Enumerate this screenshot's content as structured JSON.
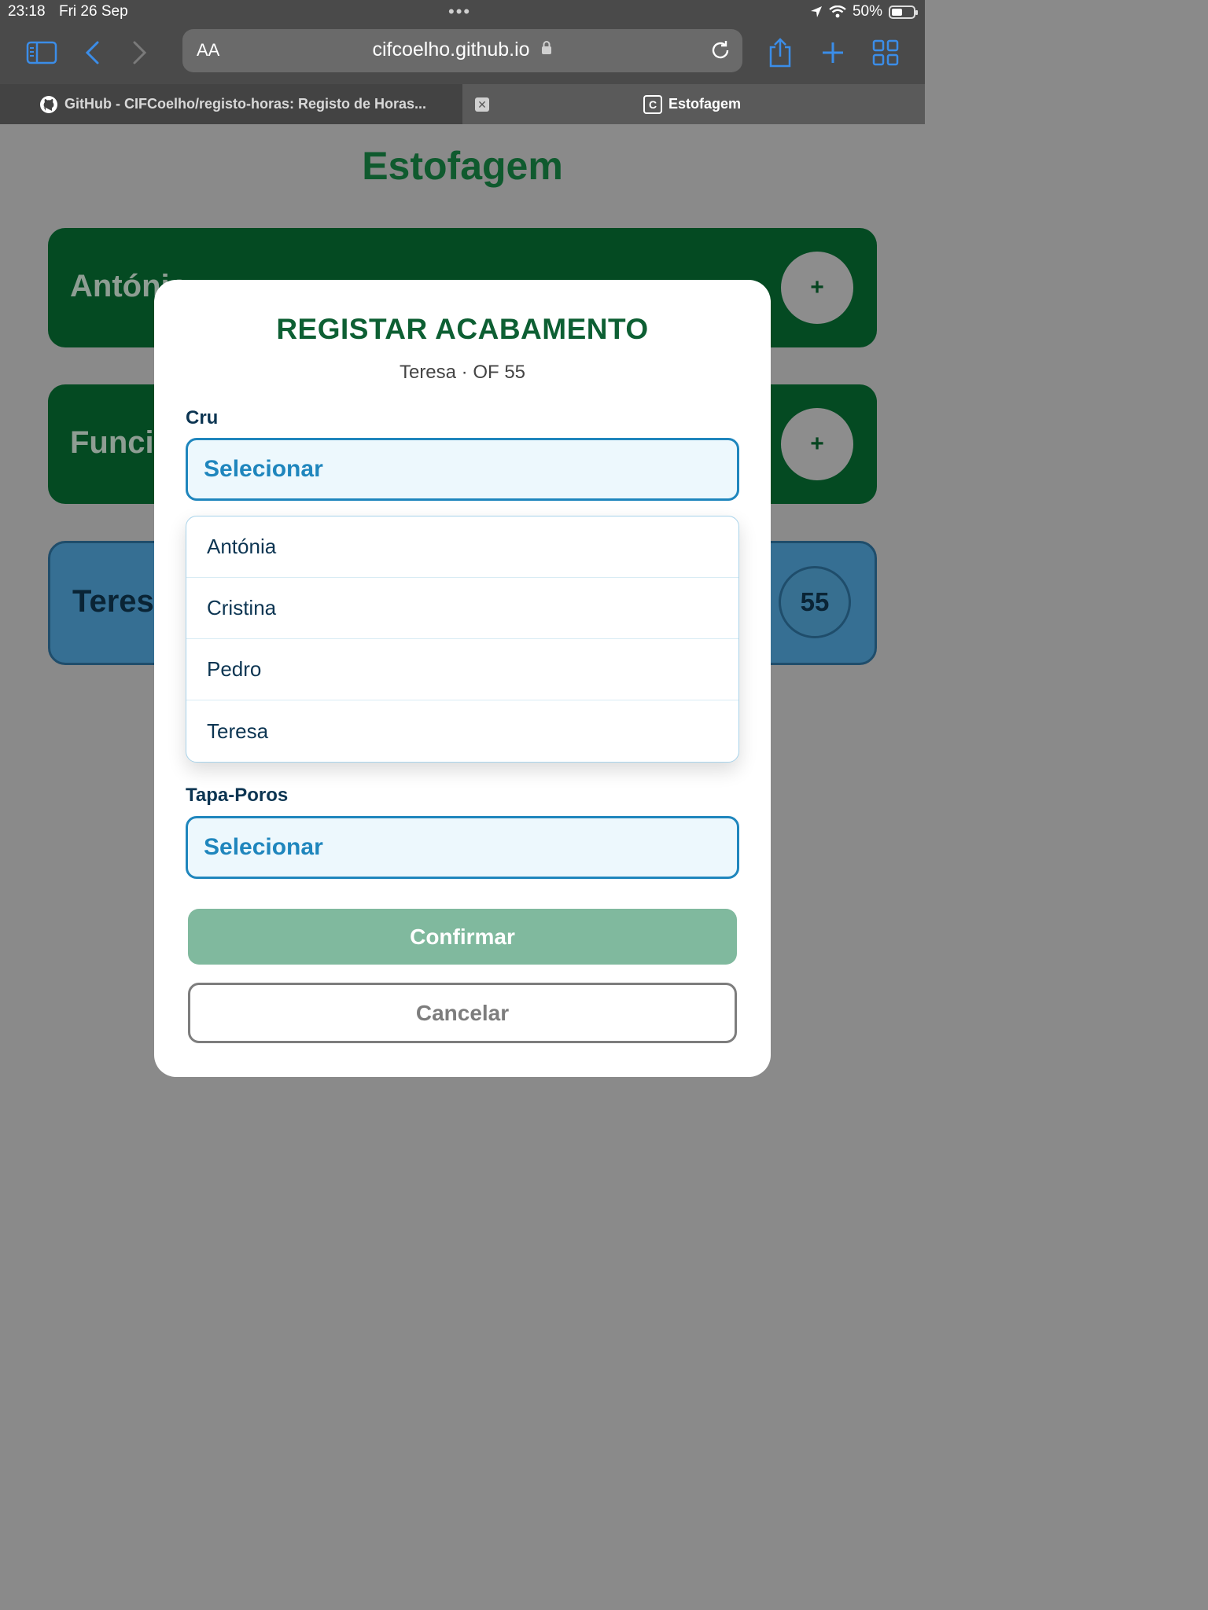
{
  "status_bar": {
    "time": "23:18",
    "date": "Fri 26 Sep",
    "battery": "50%",
    "battery_level": 0.5
  },
  "browser": {
    "text_size_label": "AA",
    "url": "cifcoelho.github.io",
    "tabs": [
      {
        "title": "GitHub - CIFCoelho/registo-horas: Registo de Horas...",
        "active": false
      },
      {
        "title": "Estofagem",
        "active": true,
        "favicon_letter": "C"
      }
    ]
  },
  "page": {
    "title": "Estofagem",
    "cards": [
      {
        "label": "António",
        "button": "+"
      },
      {
        "label": "Funcionário",
        "button": "+"
      },
      {
        "label": "Teresa",
        "badge": "55"
      }
    ]
  },
  "modal": {
    "title": "REGISTAR ACABAMENTO",
    "subtitle": "Teresa · OF 55",
    "fields": [
      {
        "label": "Cru",
        "value": "Selecionar"
      },
      {
        "label": "Tapa-Poros",
        "value": "Selecionar"
      }
    ],
    "options": [
      "Antónia",
      "Cristina",
      "Pedro",
      "Teresa"
    ],
    "confirm_label": "Confirmar",
    "cancel_label": "Cancelar"
  },
  "colors": {
    "title_green": "#0f5a2e",
    "card_green": "#044a22",
    "card_blue": "#366f93",
    "select_blue": "#1f86bd",
    "confirm_green": "#80b99e"
  }
}
